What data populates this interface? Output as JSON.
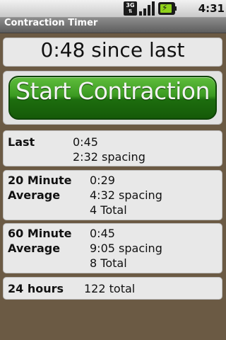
{
  "status_bar": {
    "network_label": "3G",
    "network_arrows": "⇅",
    "time": "4:31 PM",
    "icons": [
      "3g-data-icon",
      "signal-strength-icon",
      "battery-charging-icon"
    ]
  },
  "app": {
    "title": "Contraction Timer"
  },
  "since_last": "0:48 since last",
  "start_button": "Start Contraction",
  "last": {
    "label": "Last",
    "duration": "0:45",
    "spacing": "2:32 spacing"
  },
  "avg20": {
    "label_line1": "20 Minute",
    "label_line2": "Average",
    "duration": "0:29",
    "spacing": "4:32 spacing",
    "total": "4 Total"
  },
  "avg60": {
    "label_line1": "60 Minute",
    "label_line2": "Average",
    "duration": "0:45",
    "spacing": "9:05 spacing",
    "total": "8 Total"
  },
  "day": {
    "label": "24 hours",
    "total": "122 total"
  },
  "colors": {
    "background": "#6b5a44",
    "card": "#e8e8e8",
    "button_green": "#2e8a17",
    "title_bar": "#6f6f6f"
  }
}
